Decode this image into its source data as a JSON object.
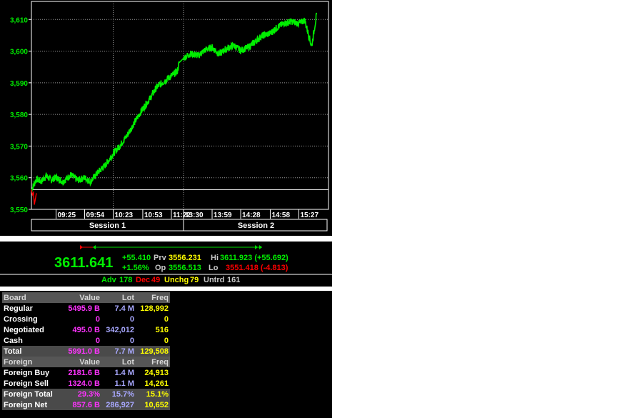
{
  "chart_data": {
    "type": "line",
    "title": "",
    "ylabel": "",
    "xlabel": "",
    "ylim": [
      3550,
      3613
    ],
    "y_ticks": [
      "3,550",
      "3,560",
      "3,570",
      "3,580",
      "3,590",
      "3,600",
      "3,610"
    ],
    "x_ticks": [
      "09:25",
      "09:54",
      "10:23",
      "10:53",
      "11:22",
      "13:30",
      "13:59",
      "14:28",
      "14:58",
      "15:27"
    ],
    "sessions": [
      "Session 1",
      "Session 2"
    ],
    "previous_close": 3556.231,
    "series": [
      {
        "color": "#00ee00",
        "points": [
          [
            "09:00",
            3556.2
          ],
          [
            "09:05",
            3559.5
          ],
          [
            "09:10",
            3558.8
          ],
          [
            "09:15",
            3560.6
          ],
          [
            "09:20",
            3559.3
          ],
          [
            "09:25",
            3560.1
          ],
          [
            "09:32",
            3558.7
          ],
          [
            "09:40",
            3560.9
          ],
          [
            "09:47",
            3559.2
          ],
          [
            "09:54",
            3560.0
          ],
          [
            "10:00",
            3558.8
          ],
          [
            "10:07",
            3561.5
          ],
          [
            "10:15",
            3564.0
          ],
          [
            "10:23",
            3567.6
          ],
          [
            "10:30",
            3570.2
          ],
          [
            "10:38",
            3573.8
          ],
          [
            "10:45",
            3577.7
          ],
          [
            "10:53",
            3581.8
          ],
          [
            "11:00",
            3584.9
          ],
          [
            "11:07",
            3588.6
          ],
          [
            "11:15",
            3590.5
          ],
          [
            "11:22",
            3592.2
          ],
          [
            "11:28",
            3593.6
          ],
          [
            "11:30",
            3596.4
          ],
          [
            "13:30",
            3597.8
          ],
          [
            "13:37",
            3599.2
          ],
          [
            "13:45",
            3598.6
          ],
          [
            "13:52",
            3600.4
          ],
          [
            "13:59",
            3601.2
          ],
          [
            "14:06",
            3599.0
          ],
          [
            "14:14",
            3600.9
          ],
          [
            "14:21",
            3601.8
          ],
          [
            "14:28",
            3600.2
          ],
          [
            "14:36",
            3601.3
          ],
          [
            "14:43",
            3603.1
          ],
          [
            "14:50",
            3604.9
          ],
          [
            "14:58",
            3605.6
          ],
          [
            "15:05",
            3607.5
          ],
          [
            "15:12",
            3608.8
          ],
          [
            "15:20",
            3609.4
          ],
          [
            "15:27",
            3608.7
          ],
          [
            "15:33",
            3609.8
          ],
          [
            "15:40",
            3601.5
          ],
          [
            "15:45",
            3611.6
          ]
        ]
      },
      {
        "color": "#ff0000",
        "points": [
          [
            "09:00",
            3556.2
          ],
          [
            "09:01",
            3554.6
          ],
          [
            "09:02",
            3555.3
          ],
          [
            "09:03",
            3551.5
          ],
          [
            "09:05",
            3555.1
          ]
        ]
      }
    ]
  },
  "summary": {
    "index_value": "3611.641",
    "change": "+55.410",
    "change_pct": "+1.56%",
    "prev_label": "Prv",
    "prev_value": "3556.231",
    "open_label": "Op",
    "open_value": "3556.513",
    "high_label": "Hi",
    "high_value": "3611.923 (+55.692)",
    "low_label": "Lo",
    "low_value": "3551.418 (-4.813)",
    "breadth": {
      "adv_label": "Adv",
      "adv": "178",
      "dec_label": "Dec",
      "dec": "49",
      "unchg_label": "Unchg",
      "unchg": "79",
      "untrd_label": "Untrd",
      "untrd": "161"
    }
  },
  "board_table": {
    "headers": [
      "Board",
      "Value",
      "Lot",
      "Freq"
    ],
    "rows": [
      {
        "name": "Regular",
        "value": "5495.9 B",
        "lot": "7.4 M",
        "freq": "128,992"
      },
      {
        "name": "Crossing",
        "value": "0",
        "lot": "0",
        "freq": "0"
      },
      {
        "name": "Negotiated",
        "value": "495.0 B",
        "lot": "342,012",
        "freq": "516"
      },
      {
        "name": "Cash",
        "value": "0",
        "lot": "0",
        "freq": "0"
      }
    ],
    "total": {
      "name": "Total",
      "value": "5991.0 B",
      "lot": "7.7 M",
      "freq": "129,508"
    }
  },
  "foreign_table": {
    "headers": [
      "Foreign",
      "Value",
      "Lot",
      "Freq"
    ],
    "rows": [
      {
        "name": "Foreign Buy",
        "value": "2181.6 B",
        "lot": "1.4 M",
        "freq": "24,913"
      },
      {
        "name": "Foreign Sell",
        "value": "1324.0 B",
        "lot": "1.1 M",
        "freq": "14,261"
      }
    ],
    "total": {
      "name": "Foreign Total",
      "value": "29.3%",
      "lot": "15.7%",
      "freq": "15.1%"
    },
    "net": {
      "name": "Foreign Net",
      "value": "857.6 B",
      "lot": "286,927",
      "freq": "10,652"
    }
  },
  "colors": {
    "price_line": "#00ee00",
    "below_prev": "#ff0000",
    "value_col": "#ff33ff",
    "lot_col": "#a8a8ff",
    "freq_col": "#ffff00"
  }
}
